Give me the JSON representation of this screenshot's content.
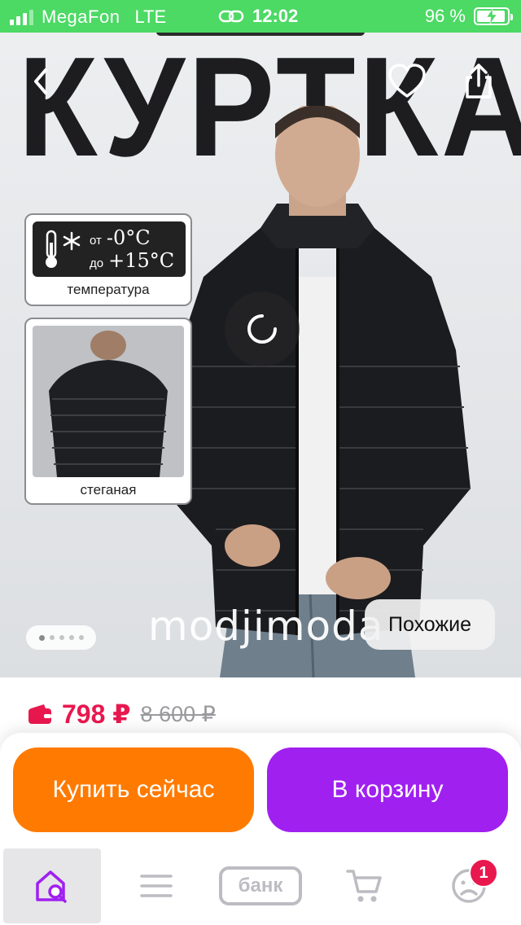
{
  "status_bar": {
    "carrier": "MegaFon",
    "network": "LTE",
    "time": "12:02",
    "battery": "96 %"
  },
  "product": {
    "hero_title": "КУРТКА",
    "temperature": {
      "from_label": "от",
      "from_value": "-0°C",
      "to_label": "до",
      "to_value": "+15°C",
      "caption": "температура"
    },
    "quilted_caption": "стеганая",
    "brand": "modjimoda",
    "similar_label": "Похожие",
    "gallery": {
      "count": 5,
      "active_index": 0
    },
    "price_now": "798 ₽",
    "price_old": "8 600 ₽"
  },
  "actions": {
    "buy_now_label": "Купить сейчас",
    "add_to_cart_label": "В корзину"
  },
  "tab_bar": {
    "bank_label": "банк",
    "notifications_count": "1",
    "active_tab": "home"
  },
  "colors": {
    "status_bar": "#4cd964",
    "price": "#e8184f",
    "buy_button": "#ff7a00",
    "cart_button": "#a020f0",
    "active_icon": "#a020f0",
    "inactive_icon": "#bcbcc2"
  }
}
